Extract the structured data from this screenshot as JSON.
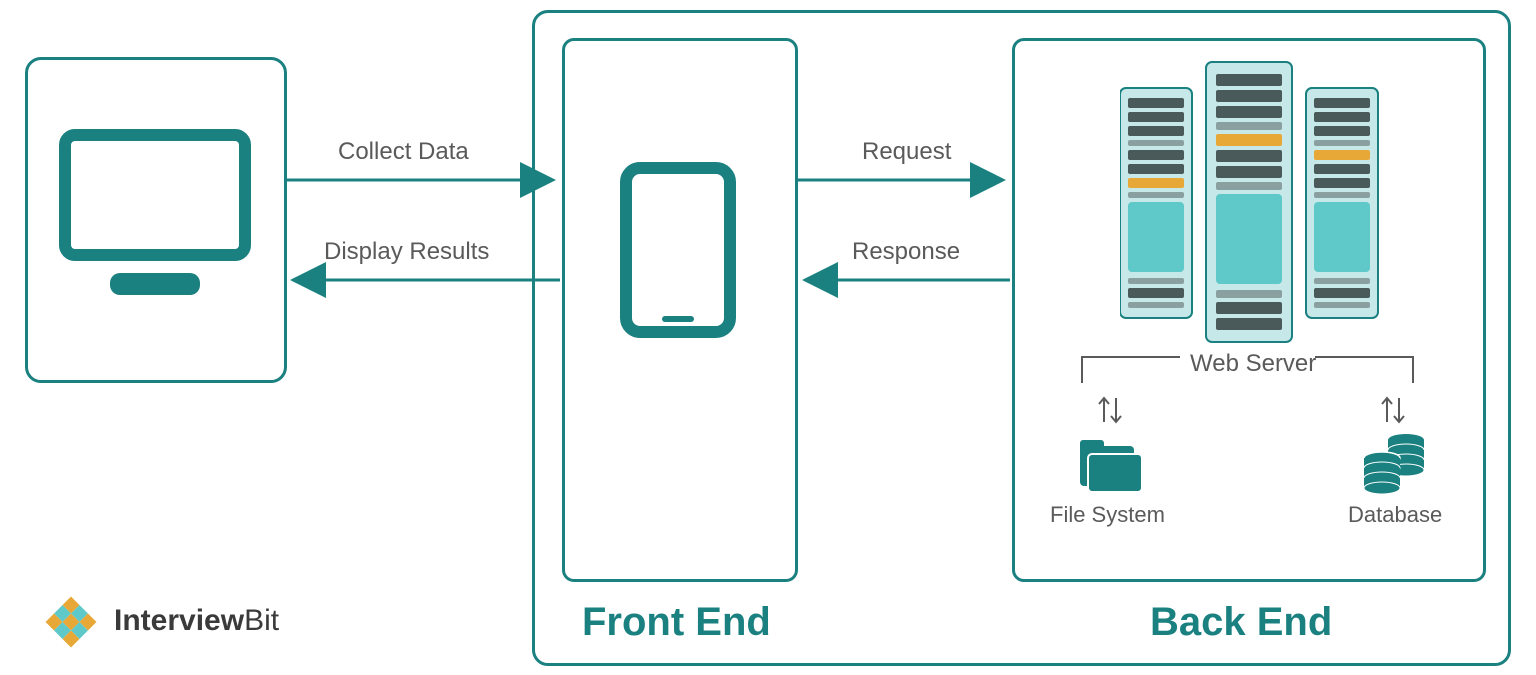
{
  "labels": {
    "collect": "Collect Data",
    "display": "Display Results",
    "request": "Request",
    "response": "Response",
    "webserver": "Web Server",
    "filesystem": "File System",
    "database": "Database"
  },
  "sections": {
    "frontend": "Front End",
    "backend": "Back End"
  },
  "brand": "InterviewBit",
  "colors": {
    "teal": "#1a8080",
    "tealLight": "#5fc8c8",
    "tealPale": "#c7e8e8",
    "gray": "#5a5a5a",
    "orange": "#e8a838",
    "darkGray": "#4a5a5a"
  }
}
